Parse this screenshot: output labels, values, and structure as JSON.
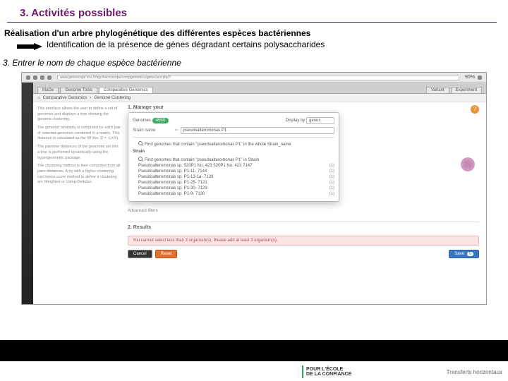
{
  "section": {
    "title": "3. Activités possibles"
  },
  "subtitle": "Réalisation d'un arbre phylogénétique des différentes espèces bactériennes",
  "desc": "Identification de la présence de gènes dégradant certains polysaccharides",
  "step": "3. Entrer le nom de chaque espèce bactérienne",
  "browser": {
    "url": "www.genoscope.cns.fr/agc/microscope/compgenomics/geneclust.php?",
    "zoom": "90%"
  },
  "tabs": [
    "MaGe",
    "Genome Tools",
    "Comparative Genomics",
    "Variant",
    "Experiment"
  ],
  "crumbs": [
    "Comparative Genomics",
    "Genome Clustering"
  ],
  "sidebar": {
    "heading": "1. Manage your",
    "para1": "This interface allows the user to define a set of genomes and displays a tree showing the genome clustering.",
    "para2": "The genomic similarity is computed for each pair of selected genomes combined in a matrix. This distance is calculated as the MI like; D = -Ln(h).",
    "para3": "The pairwise distances of the genomes set into a tree is performed dynamically using the hypergeometric package.",
    "para4": "The clustering method is then computed from all pairs distances. A try with a higher clustering can hence score method to define a clustering are Weighted or Using-Deltulan.",
    "results": "2. Results"
  },
  "popover": {
    "genomes_label": "Genomes",
    "genomes_count": "4590",
    "display_by_label": "Display by",
    "display_by_value": "genus",
    "strain_label": "Strain name",
    "strain_value": "pseudoalteromonas P1",
    "suggest1": "Find genomes that contain \"pseudoalteromonas P1\" in the whole Strain_name",
    "strain_heading": "Strain",
    "suggest2": "Find genomes that contain \"pseudoalteromonas P1\" in Strain",
    "items": [
      {
        "label": "Pseudoalteromonas sp. 520P1 No. 423 520P1 No. 423  7147",
        "count": "(1)"
      },
      {
        "label": "Pseudoalteromonas sp. P1-11- 7144",
        "count": "(1)"
      },
      {
        "label": "Pseudoalteromonas sp. P1-13-1a- 7128",
        "count": "(1)"
      },
      {
        "label": "Pseudoalteromonas sp. P1-25- 7121",
        "count": "(1)"
      },
      {
        "label": "Pseudoalteromonas sp. P1-30- 7129",
        "count": "(1)"
      },
      {
        "label": "Pseudoalteromonas sp. P1-9- 7130",
        "count": "(1)"
      }
    ],
    "advanced": "Advanced filters"
  },
  "warning": "You cannot select less than 3 organism(s). Please add at least 3 organism(s).",
  "buttons": {
    "cancel": "Cancel",
    "reset": "Reset",
    "save": "Save"
  },
  "save_badge": "0",
  "help": "?",
  "footer": {
    "logo_top": "POUR L'ÉCOLE",
    "logo_bottom": "DE LA CONFIANCE",
    "right": "Transferts horizontaux"
  }
}
